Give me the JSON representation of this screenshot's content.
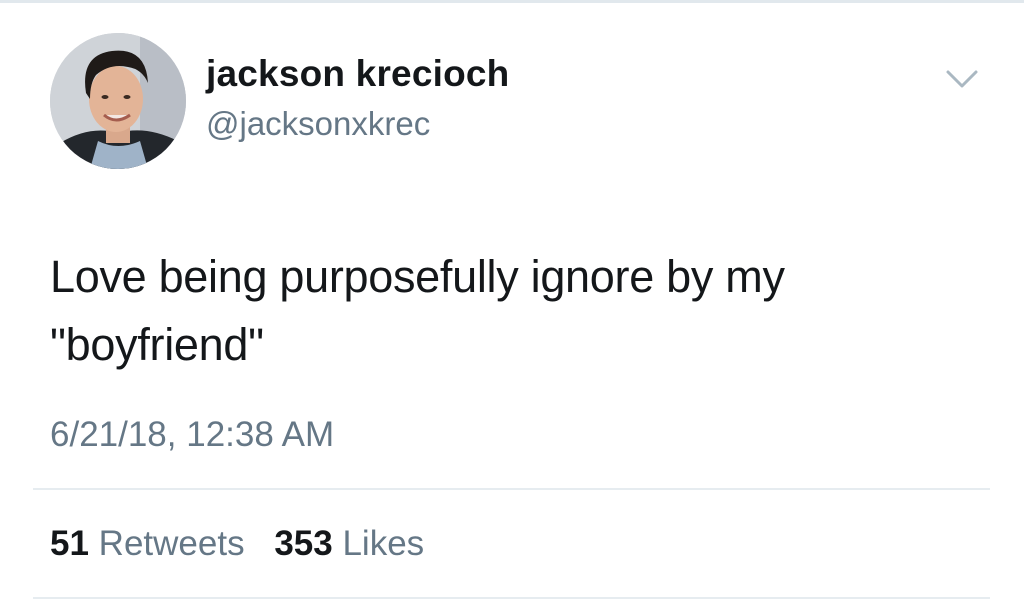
{
  "tweet": {
    "author": {
      "display_name": "jackson krecioch",
      "handle": "@jacksonxkrec",
      "avatar_icon": "profile-photo"
    },
    "menu_icon": "chevron-down-icon",
    "text_line1": "Love being purposefully ignore by my",
    "text_line2": "\"boyfriend\"",
    "timestamp": "6/21/18, 12:38 AM",
    "stats": {
      "retweets_count": "51",
      "retweets_label": "Retweets",
      "likes_count": "353",
      "likes_label": "Likes"
    }
  },
  "colors": {
    "primary_text": "#14171a",
    "secondary_text": "#657786",
    "divider": "#e6ecf0"
  }
}
